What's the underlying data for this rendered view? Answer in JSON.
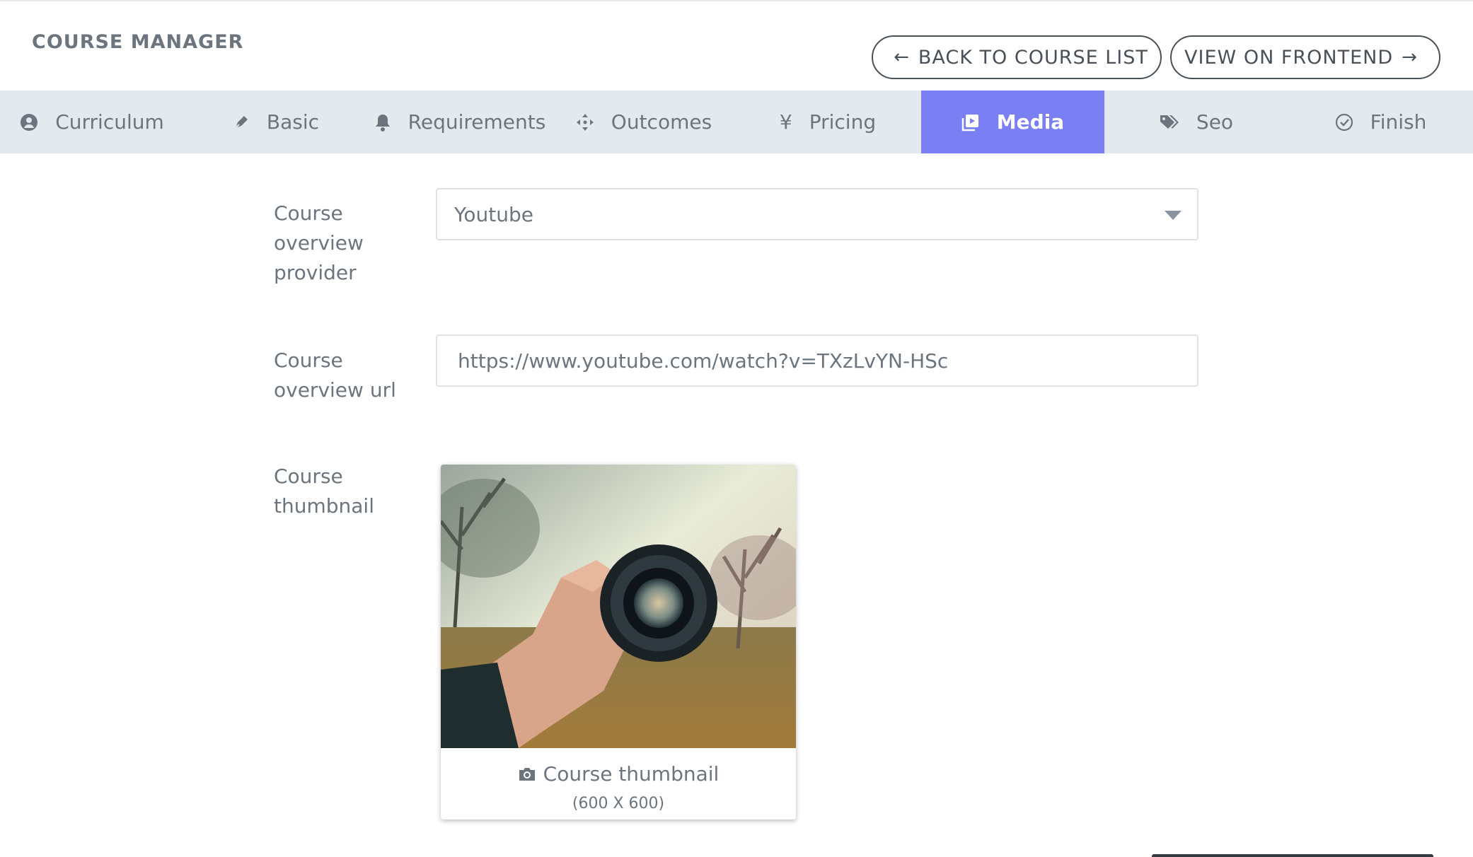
{
  "header": {
    "title": "COURSE MANAGER",
    "back_button": "BACK TO COURSE LIST",
    "frontend_button": "VIEW ON FRONTEND"
  },
  "tabs": [
    {
      "label": "Curriculum",
      "icon": "user-circle-icon",
      "active": false
    },
    {
      "label": "Basic",
      "icon": "pen-icon",
      "active": false
    },
    {
      "label": "Requirements",
      "icon": "bell-icon",
      "active": false
    },
    {
      "label": "Outcomes",
      "icon": "move-arrows-icon",
      "active": false
    },
    {
      "label": "Pricing",
      "icon": "yen-icon",
      "active": false
    },
    {
      "label": "Media",
      "icon": "media-play-icon",
      "active": true
    },
    {
      "label": "Seo",
      "icon": "tags-icon",
      "active": false
    },
    {
      "label": "Finish",
      "icon": "check-circle-icon",
      "active": false
    }
  ],
  "form": {
    "provider_label": "Course overview provider",
    "provider_value": "Youtube",
    "url_label": "Course overview url",
    "url_value": "https://www.youtube.com/watch?v=TXzLvYN-HSc",
    "thumbnail_label": "Course thumbnail",
    "thumbnail_caption": "Course thumbnail",
    "thumbnail_size": "(600 X 600)"
  },
  "colors": {
    "accent": "#7b7ff4",
    "tab_bar": "#e4e9ee",
    "text": "#6c757d"
  }
}
